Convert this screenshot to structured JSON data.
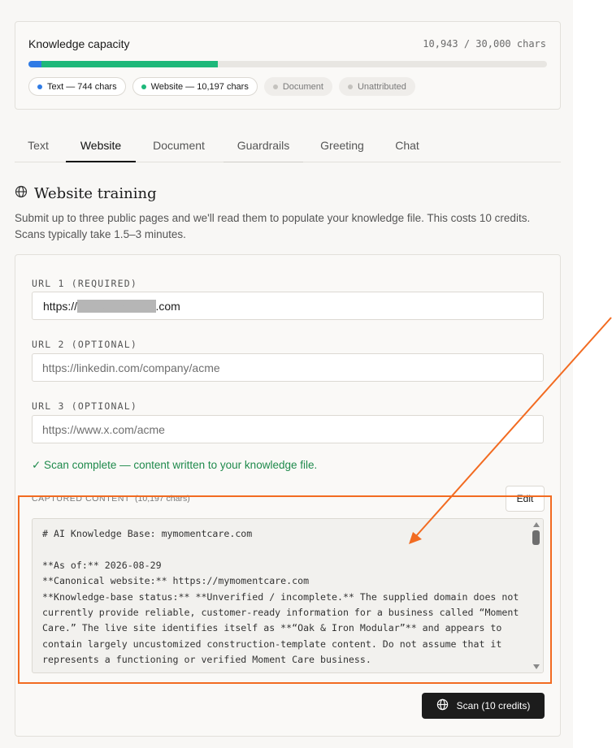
{
  "capacity": {
    "title": "Knowledge capacity",
    "count_text": "10,943 / 30,000 chars",
    "used": 10943,
    "total": 30000,
    "segments": [
      {
        "name": "Text",
        "value": 744,
        "color": "#2f7be5"
      },
      {
        "name": "Website",
        "value": 10197,
        "color": "#1db87a"
      }
    ],
    "legend": [
      {
        "label": "Text — 744 chars",
        "color": "#2f7be5",
        "muted": false
      },
      {
        "label": "Website — 10,197 chars",
        "color": "#1db87a",
        "muted": false
      },
      {
        "label": "Document",
        "color": "#c4c2be",
        "muted": true
      },
      {
        "label": "Unattributed",
        "color": "#c4c2be",
        "muted": true
      }
    ]
  },
  "tabs": [
    {
      "label": "Text",
      "active": false
    },
    {
      "label": "Website",
      "active": true
    },
    {
      "label": "Document",
      "active": false
    },
    {
      "label": "Guardrails",
      "active": false
    },
    {
      "label": "Greeting",
      "active": false
    },
    {
      "label": "Chat",
      "active": false
    }
  ],
  "section": {
    "icon": "globe-icon",
    "title": "Website training",
    "description": "Submit up to three public pages and we'll read them to populate your knowledge file. This costs 10 credits. Scans typically take 1.5–3 minutes."
  },
  "form": {
    "url1": {
      "label": "URL 1 (REQUIRED)",
      "value_prefix": "https://",
      "value_redacted": "mymomentcare",
      "value_suffix": ".com"
    },
    "url2": {
      "label": "URL 2 (OPTIONAL)",
      "placeholder": "https://linkedin.com/company/acme"
    },
    "url3": {
      "label": "URL 3 (OPTIONAL)",
      "placeholder": "https://www.x.com/acme"
    },
    "status": "✓ Scan complete — content written to your knowledge file.",
    "captured_label": "CAPTURED CONTENT",
    "captured_count": "(10,197 chars)",
    "edit_label": "Edit",
    "captured_text": "# AI Knowledge Base: mymomentcare.com\n\n**As of:** 2026-08-29\n**Canonical website:** https://mymomentcare.com\n**Knowledge-base status:** **Unverified / incomplete.** The supplied domain does not currently provide reliable, customer-ready information for a business called “Moment Care.” The live site identifies itself as **“Oak & Iron Modular”** and appears to contain largely uncustomized construction-template content. Do not assume that it represents a functioning or verified Moment Care business.",
    "scan_label": "Scan (10 credits)"
  },
  "colors": {
    "accent": "#1c1c1c",
    "success": "#1f8a4c",
    "annotation": "#f26b21"
  }
}
